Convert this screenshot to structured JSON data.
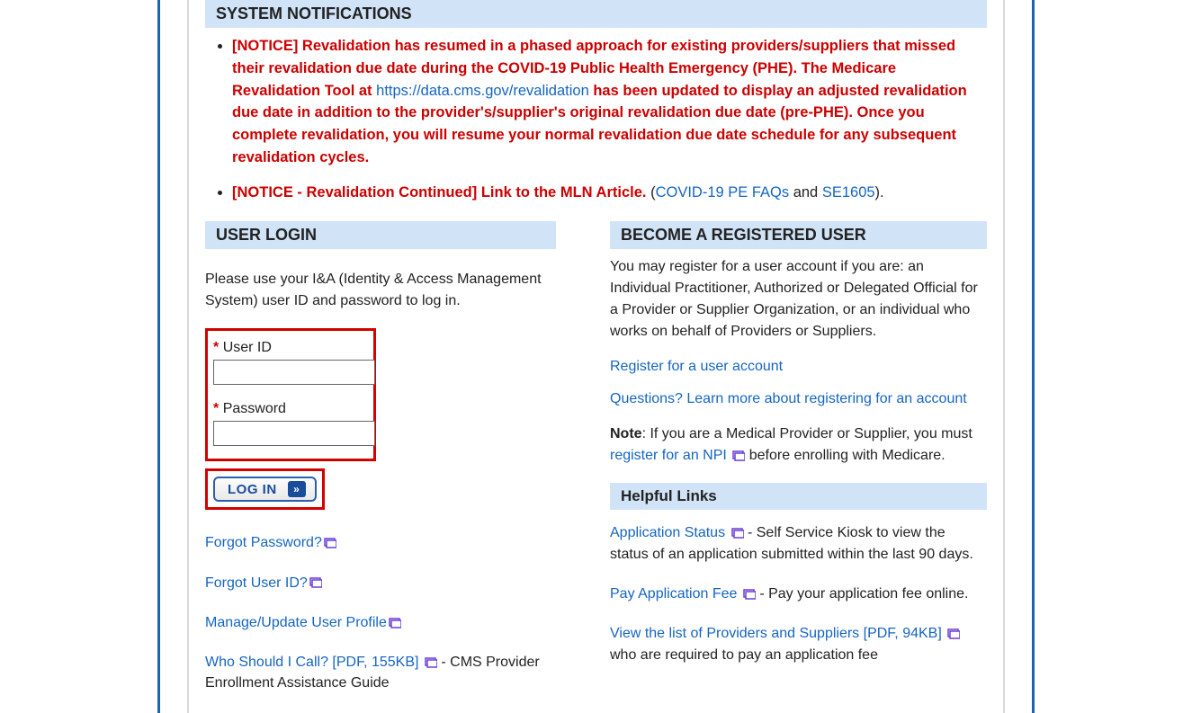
{
  "notifications": {
    "header": "SYSTEM NOTIFICATIONS",
    "item1_prefix": "[NOTICE] Revalidation has resumed in a phased approach for existing providers/suppliers that missed their revalidation due date during the COVID-19 Public Health Emergency (PHE). The Medicare Revalidation Tool at ",
    "item1_link": "https://data.cms.gov/revalidation",
    "item1_suffix": " has been updated to display an adjusted revalidation due date in addition to the provider's/supplier's original revalidation due date (pre-PHE). Once you complete revalidation, you will resume your normal revalidation due date schedule for any subsequent revalidation cycles.",
    "item2_prefix": "[NOTICE - Revalidation Continued] Link to the MLN Article.",
    "item2_paren_open": " (",
    "item2_link1": "COVID-19 PE FAQs",
    "item2_and": " and ",
    "item2_link2": "SE1605",
    "item2_paren_close": ")."
  },
  "login": {
    "header": "USER LOGIN",
    "instructions": "Please use your I&A (Identity & Access Management System) user ID and password to log in.",
    "user_id_label": "User ID",
    "password_label": "Password",
    "button_label": "LOG IN",
    "links": {
      "forgot_password": "Forgot Password?",
      "forgot_userid": "Forgot User ID?",
      "manage_profile": "Manage/Update User Profile",
      "who_call": "Who Should I Call? [PDF, 155KB]",
      "who_call_desc": " - CMS Provider Enrollment Assistance Guide"
    }
  },
  "register": {
    "header": "BECOME A REGISTERED USER",
    "intro": "You may register for a user account if you are: an Individual Practitioner, Authorized or Delegated Official for a Provider or Supplier Organization, or an individual who works on behalf of Providers or Suppliers.",
    "register_link": "Register for a user account",
    "questions_link": "Questions? Learn more about registering for an account",
    "note_label": "Note",
    "note_text": ": If you are a Medical Provider or Supplier, you must ",
    "note_link": "register for an NPI",
    "note_suffix": " before enrolling with Medicare."
  },
  "helpful": {
    "header": "Helpful Links",
    "items": {
      "app_status": "Application Status",
      "app_status_desc": " - Self Service Kiosk to view the status of an application submitted within the last 90 days.",
      "pay_fee": "Pay Application Fee",
      "pay_fee_desc": " - Pay your application fee online.",
      "view_list": "View the list of Providers and Suppliers [PDF, 94KB]",
      "view_list_desc": " who are required to pay an application fee"
    }
  }
}
